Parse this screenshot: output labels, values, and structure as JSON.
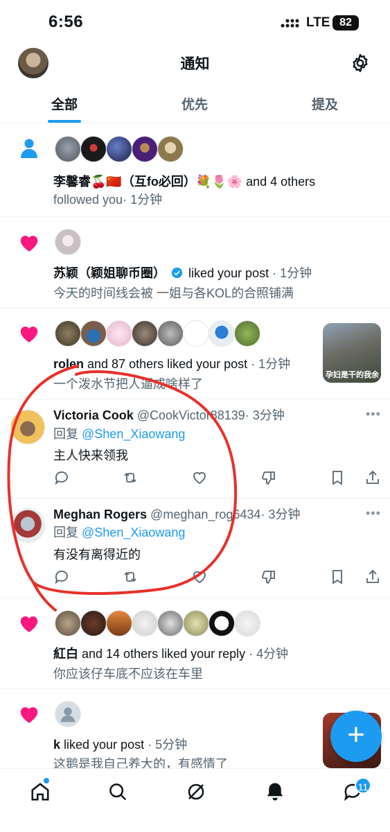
{
  "status": {
    "time": "6:56",
    "network": "LTE",
    "battery": "82"
  },
  "header": {
    "title": "通知"
  },
  "tabs": [
    {
      "label": "全部",
      "active": true
    },
    {
      "label": "优先",
      "active": false
    },
    {
      "label": "提及",
      "active": false
    }
  ],
  "notifications": [
    {
      "type": "follow",
      "actor": "李馨睿🍒🇨🇳（互fo必回）💐🌷🌸",
      "rest": " and 4 others",
      "line2": "followed you",
      "time": "· 1分钟"
    },
    {
      "type": "like",
      "actor": "苏颖（颖姐聊币圈）",
      "rest": " liked your post",
      "time": " · 1分钟",
      "snippet": "今天的时间线会被 一姐与各KOL的合照铺满"
    },
    {
      "type": "like",
      "actor": "rolen",
      "rest": " and 87 others liked your post",
      "time": " · 1分钟",
      "snippet": "一个泼水节把人逼成啥样了",
      "thumb_text": "孕妇是干的我余"
    },
    {
      "type": "like",
      "actor": "紅白",
      "rest": " and 14 others liked your reply",
      "time": " · 4分钟",
      "snippet": "你应该仔车底不应该在车里"
    },
    {
      "type": "like",
      "actor": "k",
      "rest": " liked your post",
      "time": " · 5分钟",
      "snippet": "这鹅是我自己养大的，有感情了"
    }
  ],
  "replies": [
    {
      "name": "Victoria Cook",
      "handle": "@CookVictor88139",
      "time": "· 3分钟",
      "reply_prefix": "回复 ",
      "reply_to": "@Shen_Xiaowang",
      "text": "主人快来领我"
    },
    {
      "name": "Meghan Rogers",
      "handle": "@meghan_rog6434",
      "time": "· 3分钟",
      "reply_prefix": "回复 ",
      "reply_to": "@Shen_Xiaowang",
      "text": "有没有离得近的"
    }
  ],
  "more_label": "•••",
  "fab_label": "+",
  "nav": {
    "messages_badge": "11"
  },
  "colors": {
    "accent": "#1d9bf0",
    "like": "#f91880",
    "annotation": "#e8302a"
  }
}
